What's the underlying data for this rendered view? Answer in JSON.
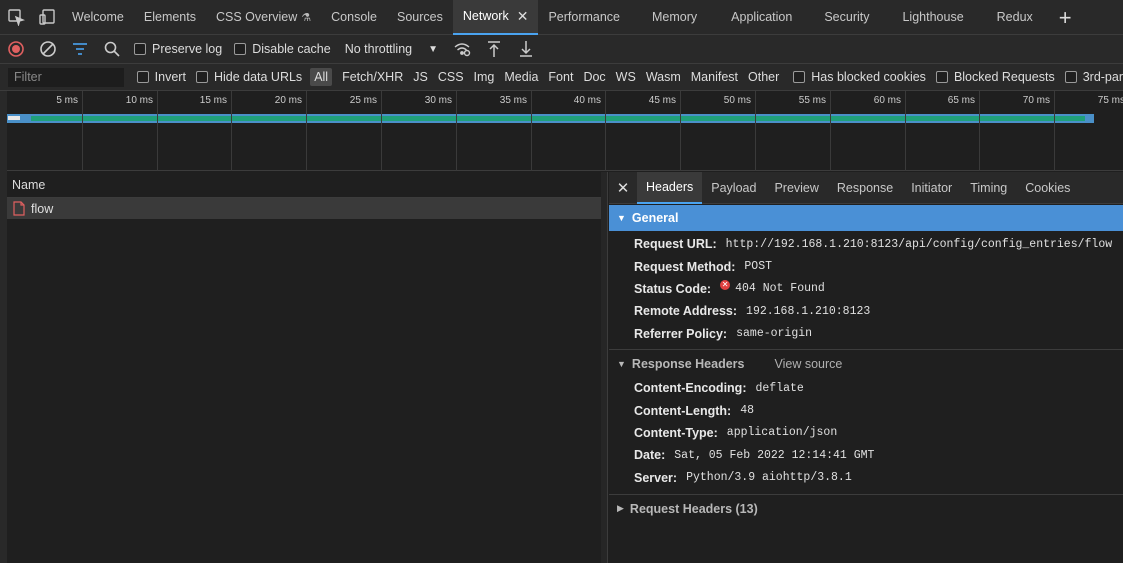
{
  "tabs": [
    {
      "label": "Welcome"
    },
    {
      "label": "Elements"
    },
    {
      "label": "CSS Overview"
    },
    {
      "label": "Console"
    },
    {
      "label": "Sources"
    },
    {
      "label": "Network",
      "active": true
    },
    {
      "label": "Performance"
    },
    {
      "label": "Memory"
    },
    {
      "label": "Application"
    },
    {
      "label": "Security"
    },
    {
      "label": "Lighthouse"
    },
    {
      "label": "Redux"
    }
  ],
  "toolbar": {
    "preserve_log": "Preserve log",
    "disable_cache": "Disable cache",
    "throttling": "No throttling"
  },
  "filter": {
    "placeholder": "Filter",
    "invert": "Invert",
    "hide_data_urls": "Hide data URLs",
    "types": [
      "All",
      "Fetch/XHR",
      "JS",
      "CSS",
      "Img",
      "Media",
      "Font",
      "Doc",
      "WS",
      "Wasm",
      "Manifest",
      "Other"
    ],
    "has_blocked_cookies": "Has blocked cookies",
    "blocked_requests": "Blocked Requests",
    "third_party": "3rd-par"
  },
  "timeline": {
    "labels": [
      "5 ms",
      "10 ms",
      "15 ms",
      "20 ms",
      "25 ms",
      "30 ms",
      "35 ms",
      "40 ms",
      "45 ms",
      "50 ms",
      "55 ms",
      "60 ms",
      "65 ms",
      "70 ms",
      "75 ms"
    ]
  },
  "requests": {
    "column_name": "Name",
    "rows": [
      {
        "name": "flow"
      }
    ]
  },
  "details": {
    "tabs": [
      "Headers",
      "Payload",
      "Preview",
      "Response",
      "Initiator",
      "Timing",
      "Cookies"
    ],
    "general": {
      "title": "General",
      "request_url_key": "Request URL:",
      "request_url": "http://192.168.1.210:8123/api/config/config_entries/flow",
      "request_method_key": "Request Method:",
      "request_method": "POST",
      "status_code_key": "Status Code:",
      "status_code": "404 Not Found",
      "remote_address_key": "Remote Address:",
      "remote_address": "192.168.1.210:8123",
      "referrer_policy_key": "Referrer Policy:",
      "referrer_policy": "same-origin"
    },
    "response_headers": {
      "title": "Response Headers",
      "view_source": "View source",
      "items": [
        {
          "k": "Content-Encoding:",
          "v": "deflate"
        },
        {
          "k": "Content-Length:",
          "v": "48"
        },
        {
          "k": "Content-Type:",
          "v": "application/json"
        },
        {
          "k": "Date:",
          "v": "Sat, 05 Feb 2022 12:14:41 GMT"
        },
        {
          "k": "Server:",
          "v": "Python/3.9 aiohttp/3.8.1"
        }
      ]
    },
    "request_headers": {
      "title": "Request Headers (13)"
    }
  },
  "colors": {
    "accent": "#4aa3f0",
    "general_bg": "#4a90d6",
    "error": "#e04040",
    "timeline_green": "#1fa07a",
    "timeline_blue": "#4a90c8"
  }
}
